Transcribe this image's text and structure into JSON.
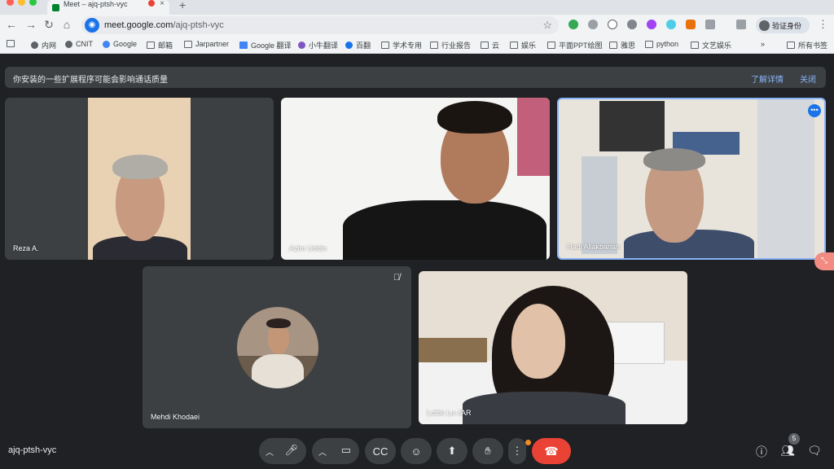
{
  "browser": {
    "tab_title": "Meet – ajq-ptsh-vyc",
    "url_domain": "meet.google.com",
    "url_path": "/ajq-ptsh-vyc",
    "profile_label": "验证身份",
    "new_tab": "+"
  },
  "bookmarks": [
    {
      "label": "内网",
      "icon": "globe-icon"
    },
    {
      "label": "CNIT",
      "icon": "globe-icon"
    },
    {
      "label": "Google",
      "icon": "google-icon"
    },
    {
      "label": "邮箱",
      "icon": "folder-icon"
    },
    {
      "label": "Jarpartner",
      "icon": "folder-icon"
    },
    {
      "label": "Google 翻译",
      "icon": "translate-icon"
    },
    {
      "label": "小牛翻译",
      "icon": "globe-icon"
    },
    {
      "label": "百翻",
      "icon": "globe-icon"
    },
    {
      "label": "学术专用",
      "icon": "folder-icon"
    },
    {
      "label": "行业报告",
      "icon": "folder-icon"
    },
    {
      "label": "云",
      "icon": "folder-icon"
    },
    {
      "label": "娱乐",
      "icon": "folder-icon"
    },
    {
      "label": "平面PPT绘图",
      "icon": "folder-icon"
    },
    {
      "label": "雅思",
      "icon": "folder-icon"
    },
    {
      "label": "python",
      "icon": "folder-icon"
    },
    {
      "label": "文艺娱乐",
      "icon": "folder-icon"
    }
  ],
  "bookmarks_more": "»",
  "all_bookmarks": "所有书签",
  "banner": {
    "message": "你安装的一些扩展程序可能会影响通话质量",
    "learn_more": "了解详情",
    "close": "关闭"
  },
  "participants": [
    {
      "name": "Reza A."
    },
    {
      "name": "Azim Uddin"
    },
    {
      "name": "Hadi Aliakbarian"
    },
    {
      "name": "Mehdi Khodaei"
    },
    {
      "name": "Lottie Lu-JAR"
    }
  ],
  "meeting_code": "ajq-ptsh-vyc",
  "participant_count": "5",
  "colors": {
    "background": "#202124",
    "tile": "#3c4043",
    "end_call": "#ea4335",
    "active_speaker_border": "#8ab4f8",
    "link": "#8ab4f8"
  }
}
